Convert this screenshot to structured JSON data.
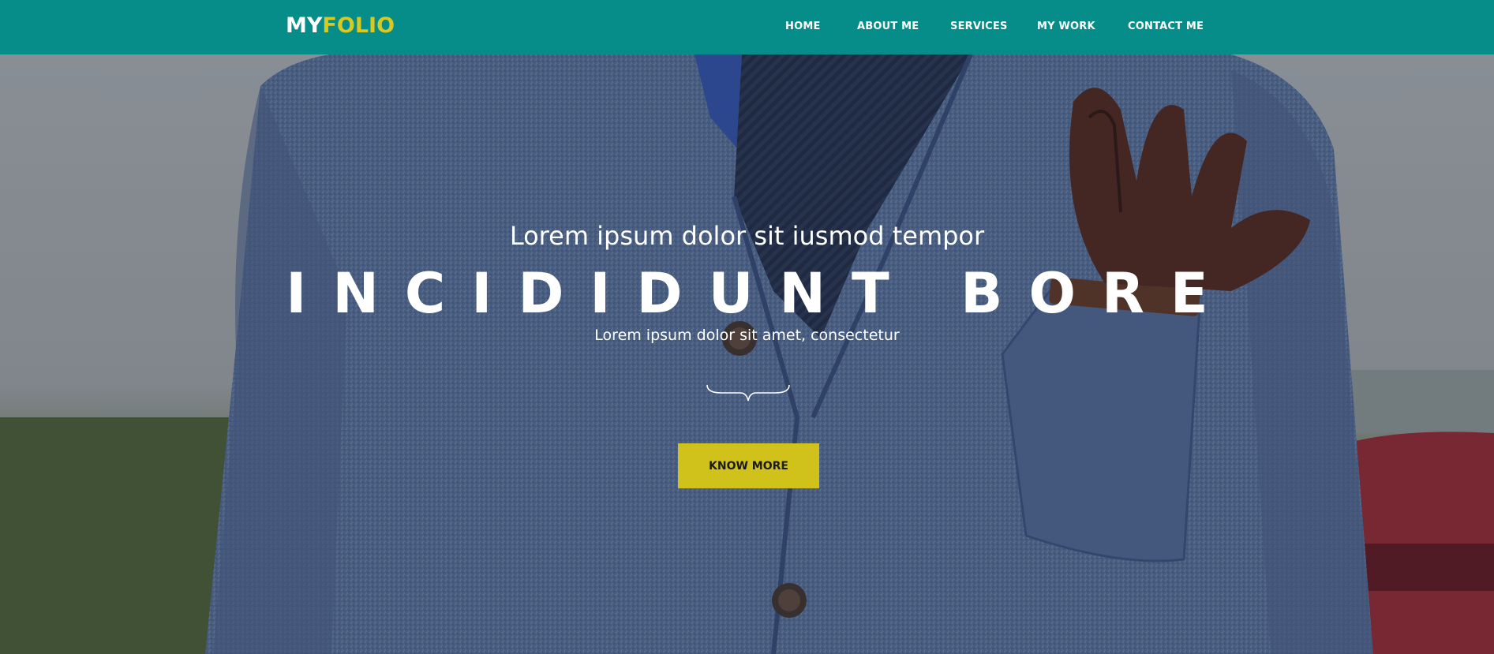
{
  "brand": {
    "part1": "MY",
    "part2": "FOLIO"
  },
  "nav": {
    "items": [
      "HOME",
      "ABOUT ME",
      "SERVICES",
      "MY WORK",
      "CONTACT ME"
    ]
  },
  "hero": {
    "subtitle": "Lorem ipsum dolor sit iusmod tempor",
    "title": "INCIDIDUNT BORE",
    "tagline": "Lorem ipsum dolor sit amet, consectetur",
    "cta_label": "KNOW MORE"
  },
  "colors": {
    "navbar": "#068d8a",
    "brand_accent": "#d9c91f",
    "cta": "#d0c21a",
    "text": "#ffffff"
  },
  "icons": [
    "curly-brace-divider-icon"
  ]
}
